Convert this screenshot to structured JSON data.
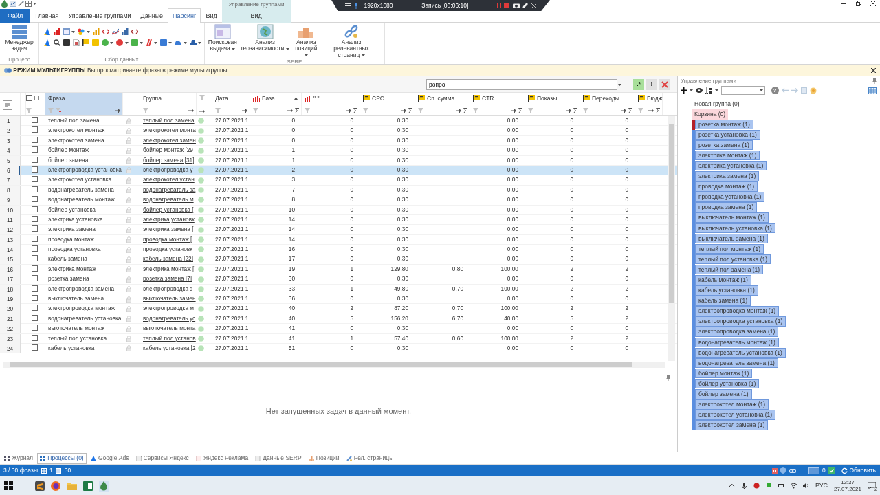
{
  "title_bar": {
    "context_group": "Управление группами"
  },
  "recorder": {
    "resolution": "1920x1080",
    "status": "Запись [00:06:10]"
  },
  "tabs": [
    {
      "label": "Файл",
      "kind": "file",
      "selected": false
    },
    {
      "label": "Главная",
      "kind": "normal",
      "selected": false
    },
    {
      "label": "Управление группами",
      "kind": "normal",
      "selected": false
    },
    {
      "label": "Данные",
      "kind": "normal",
      "selected": false
    },
    {
      "label": "Парсинг",
      "kind": "normal",
      "selected": true
    },
    {
      "label": "Вид",
      "kind": "normal",
      "selected": false
    },
    {
      "label": "Вид",
      "kind": "context",
      "selected": false
    }
  ],
  "ribbon": {
    "groups": [
      {
        "caption": "Процесс",
        "kind": "large",
        "buttons": [
          {
            "label": "Менеджер задач",
            "dropdown": false
          }
        ]
      },
      {
        "caption": "Сбор данных",
        "kind": "small"
      },
      {
        "caption": "SERP",
        "kind": "large",
        "buttons": [
          {
            "label": "Поисковая выдача",
            "dropdown": true
          },
          {
            "label": "Анализ геозависимости",
            "dropdown": true
          },
          {
            "label": "Анализ позиций",
            "dropdown": true
          },
          {
            "label": "Анализ релевантных страниц",
            "dropdown": true
          }
        ]
      }
    ]
  },
  "info_bar": {
    "text": "**РЕЖИМ МУЛЬТИГРУППЫ** Вы просматриваете фразы в режиме мультигруппы."
  },
  "search": {
    "value": "ропро",
    "buttons": [
      ".*",
      "!"
    ]
  },
  "table": {
    "select_all_checked": false,
    "columns": [
      {
        "label": "Фраза",
        "kind": "text",
        "selected": true,
        "sorted": false
      },
      {
        "label": "Группа",
        "kind": "link",
        "selected": false,
        "sorted": false
      },
      {
        "label": "Дата",
        "kind": "date",
        "selected": false,
        "sorted": false
      },
      {
        "label": "База",
        "kind": "stats",
        "selected": false,
        "sorted": true
      },
      {
        "label": "\" \"",
        "kind": "stats",
        "selected": false,
        "sorted": false
      },
      {
        "label": "CPC",
        "kind": "flag",
        "selected": false,
        "sorted": false
      },
      {
        "label": "Сп. сумма",
        "kind": "flag",
        "selected": false,
        "sorted": false
      },
      {
        "label": "CTR",
        "kind": "flag",
        "selected": false,
        "sorted": false
      },
      {
        "label": "Показы",
        "kind": "flag",
        "selected": false,
        "sorted": false
      },
      {
        "label": "Переходы",
        "kind": "flag",
        "selected": false,
        "sorted": false
      },
      {
        "label": "Бюдж",
        "kind": "flag",
        "selected": false,
        "sorted": false
      }
    ],
    "rows": [
      {
        "n": "1",
        "checked": false,
        "selected": false,
        "cells": [
          "теплый пол замена",
          "теплый пол замена",
          "27.07.2021 1",
          "0",
          "0",
          "0,30",
          null,
          "0,00",
          "0",
          "0",
          null
        ]
      },
      {
        "n": "2",
        "checked": false,
        "selected": false,
        "cells": [
          "электрокотел монтаж",
          "электрокотел монта",
          "27.07.2021 1",
          "0",
          "0",
          "0,30",
          null,
          "0,00",
          "0",
          "0",
          null
        ]
      },
      {
        "n": "3",
        "checked": false,
        "selected": false,
        "cells": [
          "электрокотел замена",
          "электрокотел замен",
          "27.07.2021 1",
          "0",
          "0",
          "0,30",
          null,
          "0,00",
          "0",
          "0",
          null
        ]
      },
      {
        "n": "4",
        "checked": false,
        "selected": false,
        "cells": [
          "бойлер монтаж",
          "бойлер монтаж [29",
          "27.07.2021 1",
          "1",
          "0",
          "0,30",
          null,
          "0,00",
          "0",
          "0",
          null
        ]
      },
      {
        "n": "5",
        "checked": false,
        "selected": false,
        "cells": [
          "бойлер замена",
          "бойлер замена [31]",
          "27.07.2021 1",
          "1",
          "0",
          "0,30",
          null,
          "0,00",
          "0",
          "0",
          null
        ]
      },
      {
        "n": "6",
        "checked": false,
        "selected": true,
        "cells": [
          "электропроводка установка",
          "электропроводка у",
          "27.07.2021 1",
          "2",
          "0",
          "0,30",
          null,
          "0,00",
          "0",
          "0",
          null
        ]
      },
      {
        "n": "7",
        "checked": false,
        "selected": false,
        "cells": [
          "электрокотел установка",
          "электрокотел устан",
          "27.07.2021 1",
          "3",
          "0",
          "0,30",
          null,
          "0,00",
          "0",
          "0",
          null
        ]
      },
      {
        "n": "8",
        "checked": false,
        "selected": false,
        "cells": [
          "водонагреватель замена",
          "водонагреватель за",
          "27.07.2021 1",
          "7",
          "0",
          "0,30",
          null,
          "0,00",
          "0",
          "0",
          null
        ]
      },
      {
        "n": "9",
        "checked": false,
        "selected": false,
        "cells": [
          "водонагреватель монтаж",
          "водонагреватель м",
          "27.07.2021 1",
          "8",
          "0",
          "0,30",
          null,
          "0,00",
          "0",
          "0",
          null
        ]
      },
      {
        "n": "10",
        "checked": false,
        "selected": false,
        "cells": [
          "бойлер установка",
          "бойлер установка [",
          "27.07.2021 1",
          "10",
          "0",
          "0,30",
          null,
          "0,00",
          "0",
          "0",
          null
        ]
      },
      {
        "n": "11",
        "checked": false,
        "selected": false,
        "cells": [
          "электрика установка",
          "электрика установк",
          "27.07.2021 1",
          "14",
          "0",
          "0,30",
          null,
          "0,00",
          "0",
          "0",
          null
        ]
      },
      {
        "n": "12",
        "checked": false,
        "selected": false,
        "cells": [
          "электрика замена",
          "электрика замена [",
          "27.07.2021 1",
          "14",
          "0",
          "0,30",
          null,
          "0,00",
          "0",
          "0",
          null
        ]
      },
      {
        "n": "13",
        "checked": false,
        "selected": false,
        "cells": [
          "проводка монтаж",
          "проводка монтаж [",
          "27.07.2021 1",
          "14",
          "0",
          "0,30",
          null,
          "0,00",
          "0",
          "0",
          null
        ]
      },
      {
        "n": "14",
        "checked": false,
        "selected": false,
        "cells": [
          "проводка установка",
          "проводка установк",
          "27.07.2021 1",
          "16",
          "0",
          "0,30",
          null,
          "0,00",
          "0",
          "0",
          null
        ]
      },
      {
        "n": "15",
        "checked": false,
        "selected": false,
        "cells": [
          "кабель замена",
          "кабель замена [22]",
          "27.07.2021 1",
          "17",
          "0",
          "0,30",
          null,
          "0,00",
          "0",
          "0",
          null
        ]
      },
      {
        "n": "16",
        "checked": false,
        "selected": false,
        "cells": [
          "электрика монтаж",
          "электрика монтаж [",
          "27.07.2021 1",
          "19",
          "1",
          "129,80",
          "0,80",
          "100,00",
          "2",
          "2",
          null
        ]
      },
      {
        "n": "17",
        "checked": false,
        "selected": false,
        "cells": [
          "розетка замена",
          "розетка замена [7]",
          "27.07.2021 1",
          "30",
          "0",
          "0,30",
          null,
          "0,00",
          "0",
          "0",
          null
        ]
      },
      {
        "n": "18",
        "checked": false,
        "selected": false,
        "cells": [
          "электропроводка замена",
          "электропроводка з",
          "27.07.2021 1",
          "33",
          "1",
          "49,80",
          "0,70",
          "100,00",
          "2",
          "2",
          null
        ]
      },
      {
        "n": "19",
        "checked": false,
        "selected": false,
        "cells": [
          "выключатель замена",
          "выключатель замен",
          "27.07.2021 1",
          "36",
          "0",
          "0,30",
          null,
          "0,00",
          "0",
          "0",
          null
        ]
      },
      {
        "n": "20",
        "checked": false,
        "selected": false,
        "cells": [
          "электропроводка монтаж",
          "электропроводка м",
          "27.07.2021 1",
          "40",
          "2",
          "87,20",
          "0,70",
          "100,00",
          "2",
          "2",
          null
        ]
      },
      {
        "n": "21",
        "checked": false,
        "selected": false,
        "cells": [
          "водонагреватель установка",
          "водонагреватель ус",
          "27.07.2021 1",
          "40",
          "5",
          "156,20",
          "6,70",
          "40,00",
          "5",
          "2",
          null
        ]
      },
      {
        "n": "22",
        "checked": false,
        "selected": false,
        "cells": [
          "выключатель монтаж",
          "выключатель монта",
          "27.07.2021 1",
          "41",
          "0",
          "0,30",
          null,
          "0,00",
          "0",
          "0",
          null
        ]
      },
      {
        "n": "23",
        "checked": false,
        "selected": false,
        "cells": [
          "теплый пол установка",
          "теплый пол установ",
          "27.07.2021 1",
          "41",
          "1",
          "57,40",
          "0,60",
          "100,00",
          "2",
          "2",
          null
        ]
      },
      {
        "n": "24",
        "checked": false,
        "selected": false,
        "cells": [
          "кабель установка",
          "кабель установка [2",
          "27.07.2021 1",
          "51",
          "0",
          "0,30",
          null,
          "0,00",
          "0",
          "0",
          null
        ]
      }
    ]
  },
  "tasks": {
    "empty_text": "Нет запущенных задач в данный момент."
  },
  "group_panel": {
    "title": "Управление группами",
    "help": "?",
    "special": [
      {
        "label": "Новая группа (0)",
        "kind": "new"
      },
      {
        "label": "Корзина (0)",
        "kind": "trash"
      }
    ],
    "groups": [
      {
        "label": "розетка монтаж (1)",
        "selected": true,
        "current": true
      },
      {
        "label": "розетка установка (1)",
        "selected": true,
        "current": false
      },
      {
        "label": "розетка замена (1)",
        "selected": true,
        "current": false
      },
      {
        "label": "электрика монтаж (1)",
        "selected": true,
        "current": false
      },
      {
        "label": "электрика установка (1)",
        "selected": true,
        "current": false
      },
      {
        "label": "электрика замена (1)",
        "selected": true,
        "current": false
      },
      {
        "label": "проводка монтаж (1)",
        "selected": true,
        "current": false
      },
      {
        "label": "проводка установка (1)",
        "selected": true,
        "current": false
      },
      {
        "label": "проводка замена (1)",
        "selected": true,
        "current": false
      },
      {
        "label": "выключатель монтаж (1)",
        "selected": true,
        "current": false
      },
      {
        "label": "выключатель установка (1)",
        "selected": true,
        "current": false
      },
      {
        "label": "выключатель замена (1)",
        "selected": true,
        "current": false
      },
      {
        "label": "теплый пол монтаж (1)",
        "selected": true,
        "current": false
      },
      {
        "label": "теплый пол установка (1)",
        "selected": true,
        "current": false
      },
      {
        "label": "теплый пол замена (1)",
        "selected": true,
        "current": false
      },
      {
        "label": "кабель монтаж (1)",
        "selected": true,
        "current": false
      },
      {
        "label": "кабель установка (1)",
        "selected": true,
        "current": false
      },
      {
        "label": "кабель замена (1)",
        "selected": true,
        "current": false
      },
      {
        "label": "электропроводка монтаж (1)",
        "selected": true,
        "current": false
      },
      {
        "label": "электропроводка установка (1)",
        "selected": true,
        "current": false
      },
      {
        "label": "электропроводка замена (1)",
        "selected": true,
        "current": false
      },
      {
        "label": "водонагреватель монтаж (1)",
        "selected": true,
        "current": false
      },
      {
        "label": "водонагреватель установка (1)",
        "selected": true,
        "current": false
      },
      {
        "label": "водонагреватель замена (1)",
        "selected": true,
        "current": false
      },
      {
        "label": "бойлер монтаж (1)",
        "selected": true,
        "current": false
      },
      {
        "label": "бойлер установка (1)",
        "selected": true,
        "current": false
      },
      {
        "label": "бойлер замена (1)",
        "selected": true,
        "current": false
      },
      {
        "label": "электрокотел монтаж (1)",
        "selected": true,
        "current": false
      },
      {
        "label": "электрокотел установка (1)",
        "selected": true,
        "current": false
      },
      {
        "label": "электрокотел замена (1)",
        "selected": true,
        "current": false
      }
    ]
  },
  "bottom_tabs": [
    {
      "label": "Журнал",
      "selected": false
    },
    {
      "label": "Процессы (0)",
      "selected": true
    },
    {
      "label": "Google.Ads",
      "selected": false
    },
    {
      "label": "Сервисы Яндекс",
      "selected": false
    },
    {
      "label": "Яндекс Реклама",
      "selected": false
    },
    {
      "label": "Данные SERP",
      "selected": false
    },
    {
      "label": "Позиции",
      "selected": false
    },
    {
      "label": "Рел. страницы",
      "selected": false
    }
  ],
  "status_bar": {
    "phrases": "3 / 30 фразы",
    "count_a": "1",
    "count_b": "30",
    "count_c": "0",
    "refresh": "Обновить"
  },
  "taskbar": {
    "lang": "РУС",
    "time": "13:37",
    "date": "27.07.2021",
    "notifications": "2"
  }
}
